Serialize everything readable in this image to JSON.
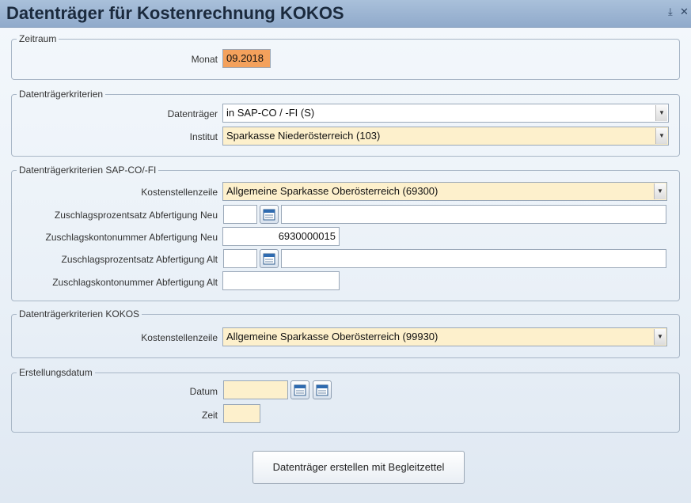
{
  "window": {
    "title": "Datenträger für Kostenrechnung KOKOS",
    "restore_icon": "minimize-icon",
    "close_icon": "close-icon"
  },
  "zeitraum": {
    "legend": "Zeitraum",
    "monat_label": "Monat",
    "monat_value": "09.2018"
  },
  "kriterien": {
    "legend": "Datenträgerkriterien",
    "datentraeger_label": "Datenträger",
    "datentraeger_value": "in SAP-CO / -FI (S)",
    "institut_label": "Institut",
    "institut_value": "Sparkasse Niederösterreich (103)"
  },
  "sapco": {
    "legend": "Datenträgerkriterien SAP-CO/-FI",
    "kostenstellenzeile_label": "Kostenstellenzeile",
    "kostenstellenzeile_value": "Allgemeine Sparkasse Oberösterreich (69300)",
    "zps_neu_label": "Zuschlagsprozentsatz Abfertigung Neu",
    "zps_neu_value": "",
    "zps_neu_desc": "",
    "zkn_neu_label": "Zuschlagskontonummer Abfertigung Neu",
    "zkn_neu_value": "6930000015",
    "zps_alt_label": "Zuschlagsprozentsatz Abfertigung Alt",
    "zps_alt_value": "",
    "zps_alt_desc": "",
    "zkn_alt_label": "Zuschlagskontonummer Abfertigung Alt",
    "zkn_alt_value": ""
  },
  "kokos": {
    "legend": "Datenträgerkriterien KOKOS",
    "kostenstellenzeile_label": "Kostenstellenzeile",
    "kostenstellenzeile_value": "Allgemeine Sparkasse Oberösterreich (99930)"
  },
  "erstellung": {
    "legend": "Erstellungsdatum",
    "datum_label": "Datum",
    "datum_value": "",
    "zeit_label": "Zeit",
    "zeit_value": ""
  },
  "actions": {
    "create_label": "Datenträger erstellen mit Begleitzettel"
  },
  "colors": {
    "title_bar": "#90aacb",
    "field_yellow": "#fdf0cc",
    "field_orange": "#f4a15c"
  }
}
